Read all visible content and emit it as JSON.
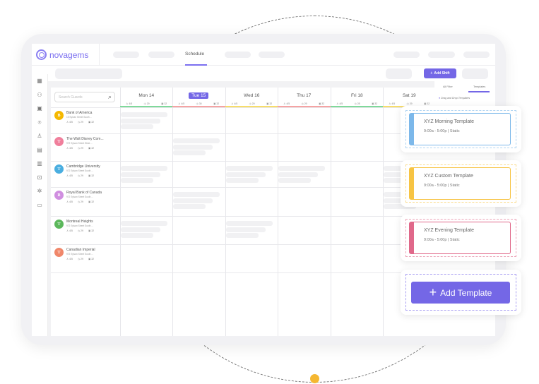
{
  "app": {
    "brand": "novagems",
    "nav_active": "Schedule",
    "add_shift": "Add Shift"
  },
  "colors": {
    "accent": "#7467e6",
    "mon": "#7fd99a",
    "tue": "#f5a3a3",
    "wed": "#f7dd6a",
    "thu": "#f5a3a3",
    "fri": "#7fd99a",
    "sat": "#f7dd6a"
  },
  "sidebar_icons": [
    "dashboard-icon",
    "binoculars-icon",
    "calendar-icon",
    "location-icon",
    "user-icon",
    "id-card-icon",
    "chart-icon",
    "lock-icon",
    "settings-icon",
    "message-icon"
  ],
  "search": {
    "placeholder": "Search Guards"
  },
  "days": [
    {
      "label": "Mon 14",
      "guards": "4/5",
      "hours": "29",
      "shifts": "32",
      "selected": false
    },
    {
      "label": "Tue 15",
      "guards": "4/5",
      "hours": "30",
      "shifts": "32",
      "selected": true
    },
    {
      "label": "Wed 16",
      "guards": "4/5",
      "hours": "29",
      "shifts": "32",
      "selected": false
    },
    {
      "label": "Thu 17",
      "guards": "4/5",
      "hours": "29",
      "shifts": "32",
      "selected": false
    },
    {
      "label": "Fri 18",
      "guards": "4/5",
      "hours": "28",
      "shifts": "32",
      "selected": false
    },
    {
      "label": "Sat 19",
      "guards": "4/5",
      "hours": "29",
      "shifts": "32",
      "selected": false
    }
  ],
  "guards": [
    {
      "initial": "B",
      "name": "Bank of America",
      "address": "15 Sylvan Street South ...",
      "guards": "4/5",
      "hours": "29",
      "shifts": "32",
      "color": "#f5b800"
    },
    {
      "initial": "T",
      "name": "The Walt Disney Com...",
      "address": "972 Sylvan Street West ...",
      "guards": "4/5",
      "hours": "29",
      "shifts": "32",
      "color": "#f07f9c"
    },
    {
      "initial": "T",
      "name": "Cambridge University",
      "address": "972 Sylvan Street South ...",
      "guards": "4/5",
      "hours": "29",
      "shifts": "32",
      "color": "#4aaee0"
    },
    {
      "initial": "R",
      "name": "Royal Bank of Canada",
      "address": "972 Sylvan Street South ...",
      "guards": "4/5",
      "hours": "29",
      "shifts": "32",
      "color": "#d08ee0"
    },
    {
      "initial": "T",
      "name": "Montreal Heights",
      "address": "972 Sylvan Street South ...",
      "guards": "4/5",
      "hours": "29",
      "shifts": "32",
      "color": "#5cb85c"
    },
    {
      "initial": "T",
      "name": "Canadian Imperial",
      "address": "972 Sylvan Street South ...",
      "guards": "4/5",
      "hours": "29",
      "shifts": "32",
      "color": "#f0876a"
    }
  ],
  "shift_placeholders": [
    [
      0,
      0
    ],
    [
      1,
      1
    ],
    [
      2,
      0
    ],
    [
      2,
      2
    ],
    [
      2,
      3
    ],
    [
      2,
      5
    ],
    [
      3,
      1
    ],
    [
      3,
      5
    ],
    [
      4,
      0
    ],
    [
      4,
      2
    ]
  ],
  "panel": {
    "tabs": [
      "All Filter",
      "Templates"
    ],
    "active_tab": "Templates",
    "hint": "Drag and Drop Templates"
  },
  "templates": [
    {
      "name": "XYZ Morning Template",
      "time": "9:00a - 5:00p | Static",
      "color": "#7cb8ea"
    },
    {
      "name": "XYZ Custom Template",
      "time": "9:00a - 5:00p | Static",
      "color": "#f7c443"
    },
    {
      "name": "XYZ Evening Template",
      "time": "9:00a - 5:00p | Static",
      "color": "#e0688a"
    }
  ],
  "add_template": "Add Template"
}
